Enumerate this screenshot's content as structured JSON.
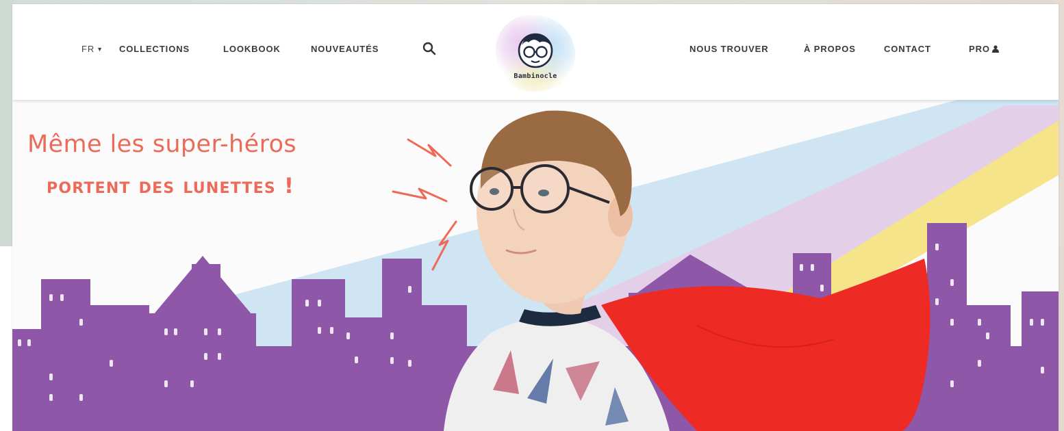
{
  "header": {
    "language": {
      "label": "FR",
      "caret": "▼"
    },
    "nav_left": [
      {
        "label": "COLLECTIONS"
      },
      {
        "label": "LOOKBOOK"
      },
      {
        "label": "NOUVEAUTÉS"
      }
    ],
    "search_icon": "search-icon",
    "logo": {
      "text": "Bambinocle"
    },
    "nav_right": [
      {
        "label": "NOUS TROUVER"
      },
      {
        "label": "À PROPOS"
      },
      {
        "label": "CONTACT"
      },
      {
        "label": "PRO"
      }
    ],
    "pro_icon": "user-icon"
  },
  "hero": {
    "headline_line1": "Même les super-héros",
    "headline_line2": "portent des lunettes !",
    "colors": {
      "headline": "#ec6a58",
      "buildings": "#8e57a8",
      "cape": "#ee2a24",
      "ray_blue": "#cfe5f3",
      "ray_lilac": "#e3cfe8",
      "ray_yellow": "#f5e48a"
    }
  }
}
